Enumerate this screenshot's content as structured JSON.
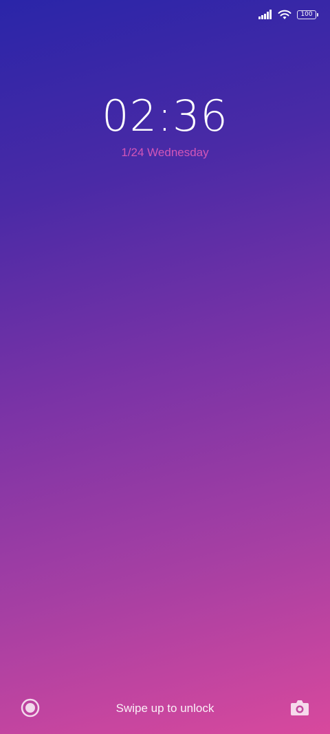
{
  "status_bar": {
    "signal_icon": "signal-strength-icon",
    "wifi_icon": "wifi-icon",
    "battery_level": "100"
  },
  "lock_screen": {
    "time": "02:36",
    "date": "1/24 Wednesday",
    "unlock_hint": "Swipe up to unlock",
    "left_shortcut_icon": "circle-target-icon",
    "right_shortcut_icon": "camera-icon"
  },
  "colors": {
    "gradient_top": "#2a25a8",
    "gradient_bottom": "#d8499d",
    "date_text": "#d256b8"
  }
}
